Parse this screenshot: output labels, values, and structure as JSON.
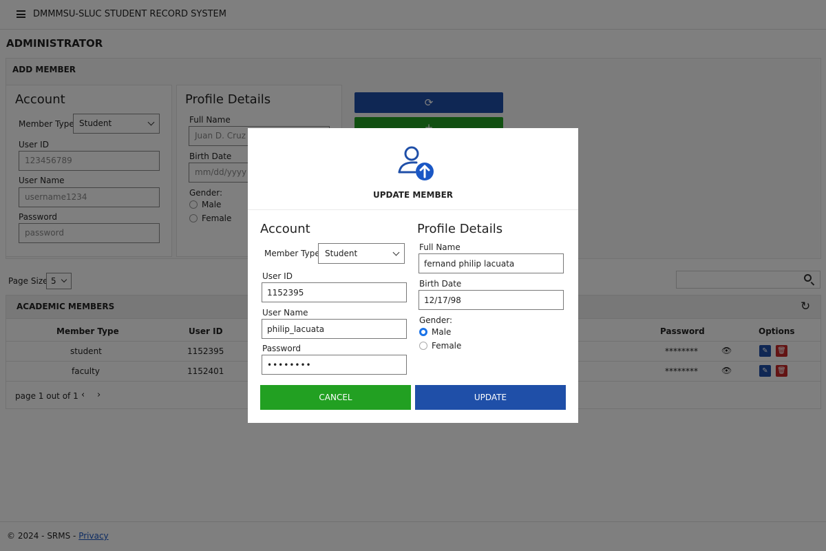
{
  "header": {
    "app_title": "DMMMSU-SLUC STUDENT RECORD SYSTEM"
  },
  "page": {
    "role_title": "ADMINISTRATOR"
  },
  "add_member": {
    "section_title": "ADD MEMBER",
    "account": {
      "heading": "Account",
      "member_type_label": "Member Type",
      "member_type_value": "Student",
      "user_id_label": "User ID",
      "user_id_placeholder": "123456789",
      "user_name_label": "User Name",
      "user_name_placeholder": "username1234",
      "password_label": "Password",
      "password_placeholder": "password"
    },
    "profile": {
      "heading": "Profile Details",
      "full_name_label": "Full Name",
      "full_name_placeholder": "Juan D. Cruz",
      "birth_date_label": "Birth Date",
      "birth_date_placeholder": "mm/dd/yyyy",
      "gender_label": "Gender:",
      "male_label": "Male",
      "female_label": "Female"
    },
    "add_glyph": "+"
  },
  "list": {
    "page_size_label": "Page Size",
    "page_size_value": "5",
    "section_title": "ACADEMIC MEMBERS",
    "columns": {
      "member_type": "Member Type",
      "user_id": "User ID",
      "password": "Password",
      "options": "Options"
    },
    "rows": [
      {
        "member_type": "student",
        "user_id": "1152395",
        "password": "********"
      },
      {
        "member_type": "faculty",
        "user_id": "1152401",
        "password": "********"
      }
    ],
    "pagination_text": "page 1 out of 1"
  },
  "footer": {
    "copyright": "© 2024 - SRMS - ",
    "privacy_link": "Privacy"
  },
  "modal": {
    "title": "UPDATE MEMBER",
    "account": {
      "heading": "Account",
      "member_type_label": "Member Type",
      "member_type_value": "Student",
      "user_id_label": "User ID",
      "user_id_value": "1152395",
      "user_name_label": "User Name",
      "user_name_value": "philip_lacuata",
      "password_label": "Password",
      "password_value": "••••••••"
    },
    "profile": {
      "heading": "Profile Details",
      "full_name_label": "Full Name",
      "full_name_value": "fernand philip lacuata",
      "birth_date_label": "Birth Date",
      "birth_date_value": "12/17/98",
      "gender_label": "Gender:",
      "male_label": "Male",
      "female_label": "Female",
      "selected_gender": "Male"
    },
    "cancel_label": "CANCEL",
    "update_label": "UPDATE"
  },
  "colors": {
    "primary": "#1f4fa8",
    "success": "#22a022",
    "danger": "#c62828",
    "radio_accent": "#1a73e8"
  },
  "icons": [
    "menu-icon",
    "refresh-icon",
    "search-icon",
    "view-password-icon",
    "edit-icon",
    "delete-icon",
    "user-upload-icon",
    "chevron-left-icon",
    "chevron-right-icon"
  ]
}
